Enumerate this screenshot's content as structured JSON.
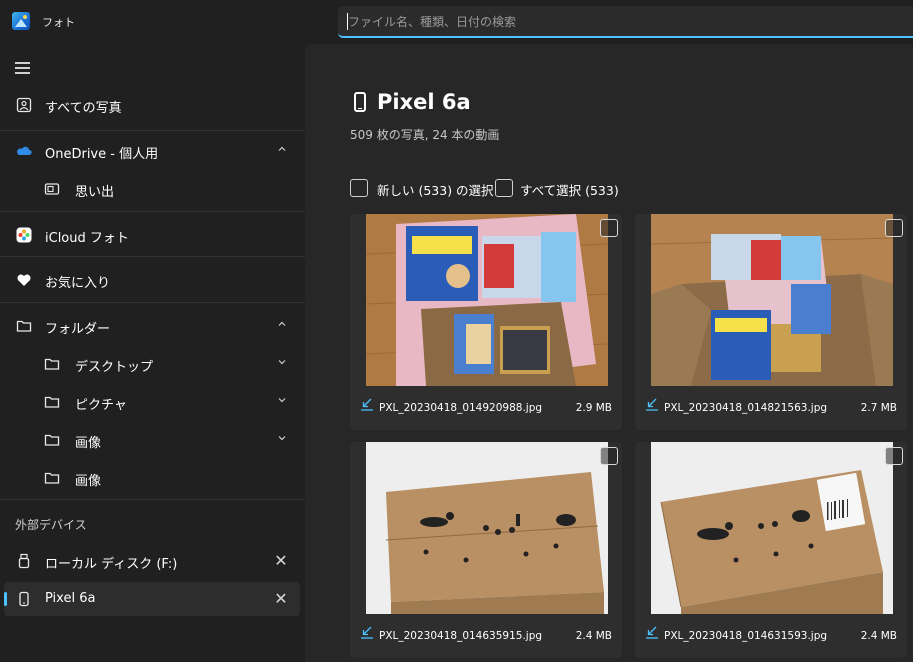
{
  "app": {
    "title": "フォト"
  },
  "search": {
    "placeholder": "ファイル名、種類、日付の検索"
  },
  "sidebar": {
    "items": [
      {
        "label": "すべての写真",
        "icon": "photo-icon"
      },
      {
        "label": "OneDrive - 個人用",
        "icon": "onedrive-cloud-icon"
      },
      {
        "label": "思い出",
        "icon": "memories-icon"
      },
      {
        "label": "iCloud フォト",
        "icon": "icloud-photos-icon"
      },
      {
        "label": "お気に入り",
        "icon": "heart-icon"
      },
      {
        "label": "フォルダー",
        "icon": "folder-icon"
      },
      {
        "label": "デスクトップ",
        "icon": "folder-icon"
      },
      {
        "label": "ピクチャ",
        "icon": "folder-icon"
      },
      {
        "label": "画像",
        "icon": "folder-icon"
      },
      {
        "label": "画像",
        "icon": "folder-icon"
      }
    ],
    "devices_header": "外部デバイス",
    "devices": [
      {
        "label": "ローカル ディスク (F:)",
        "icon": "usb-drive-icon"
      },
      {
        "label": "Pixel 6a",
        "icon": "phone-icon",
        "selected": true
      }
    ]
  },
  "main": {
    "title": "Pixel 6a",
    "subtitle": "509 枚の写真, 24 本の動画",
    "select_new_label": "新しい (533) の選択",
    "select_all_label": "すべて選択 (533)",
    "photos": [
      {
        "filename": "PXL_20230418_014920988.jpg",
        "size": "2.9 MB"
      },
      {
        "filename": "PXL_20230418_014821563.jpg",
        "size": "2.7 MB"
      },
      {
        "filename": "PXL_20230418_014635915.jpg",
        "size": "2.4 MB"
      },
      {
        "filename": "PXL_20230418_014631593.jpg",
        "size": "2.4 MB"
      }
    ]
  },
  "colors": {
    "accent": "#4cc2ff",
    "background": "#202020",
    "panel": "#272727",
    "card": "#2e2e2e"
  }
}
